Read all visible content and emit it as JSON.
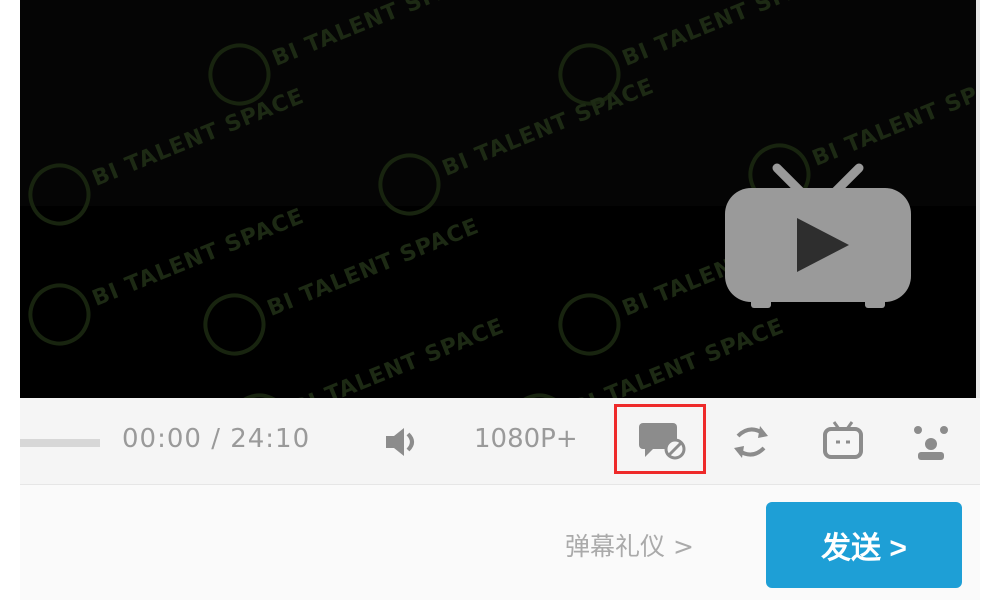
{
  "player": {
    "watermark_text": "BI TALENT SPACE",
    "time_display": "00:00 / 24:10",
    "quality_label": "1080P+"
  },
  "controls": {
    "icons": [
      "volume-icon",
      "danmaku-toggle-icon",
      "loop-icon",
      "bilibili-tv-icon",
      "settings-icon"
    ]
  },
  "send_bar": {
    "etiquette_link": "弹幕礼仪 >",
    "send_label": "发送 >"
  },
  "colors": {
    "video_bg": "#050505",
    "send_button": "#1e9fd6",
    "highlight_border": "#ee2a2a",
    "control_bar": "#f5f5f5"
  }
}
